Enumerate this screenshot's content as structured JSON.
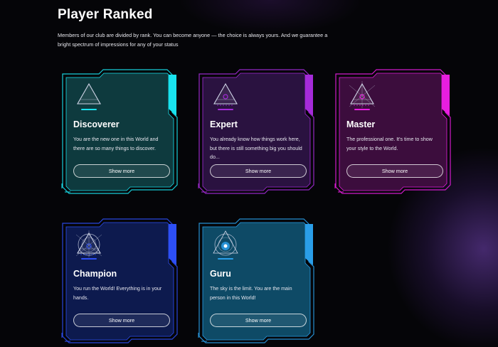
{
  "header": {
    "title": "Player Ranked",
    "description": "Members of our club are divided by rank. You can become anyone — the choice is always yours. And we guarantee a bright spectrum of impressions for any of your status"
  },
  "cards": [
    {
      "name": "Discoverer",
      "text": "You are the new one in this World and there are so many things to discover.",
      "button": "Show more",
      "emblem": "triangle-emblem-icon",
      "accent": "#19e3ef",
      "fill": "#0e3a3e"
    },
    {
      "name": "Expert",
      "text": "You already know how things work here, but there is still something big you should do...",
      "button": "Show more",
      "emblem": "triangle-rays-emblem-icon",
      "accent": "#a52bd9",
      "fill": "#2a1240"
    },
    {
      "name": "Master",
      "text": "The professional one. It's time to show your style to the World.",
      "button": "Show more",
      "emblem": "triangle-crosshair-emblem-icon",
      "accent": "#e81ee0",
      "fill": "#3c0d3d"
    },
    {
      "name": "Champion",
      "text": "You run the World! Everything is in your hands.",
      "button": "Show more",
      "emblem": "circle-triangle-emblem-icon",
      "accent": "#2d4ff5",
      "fill": "#0d1a4e"
    },
    {
      "name": "Guru",
      "text": "The sky is the limit. You are the main person in this World!",
      "button": "Show more",
      "emblem": "circle-target-emblem-icon",
      "accent": "#2a9ee8",
      "fill": "#0e4a66"
    }
  ]
}
